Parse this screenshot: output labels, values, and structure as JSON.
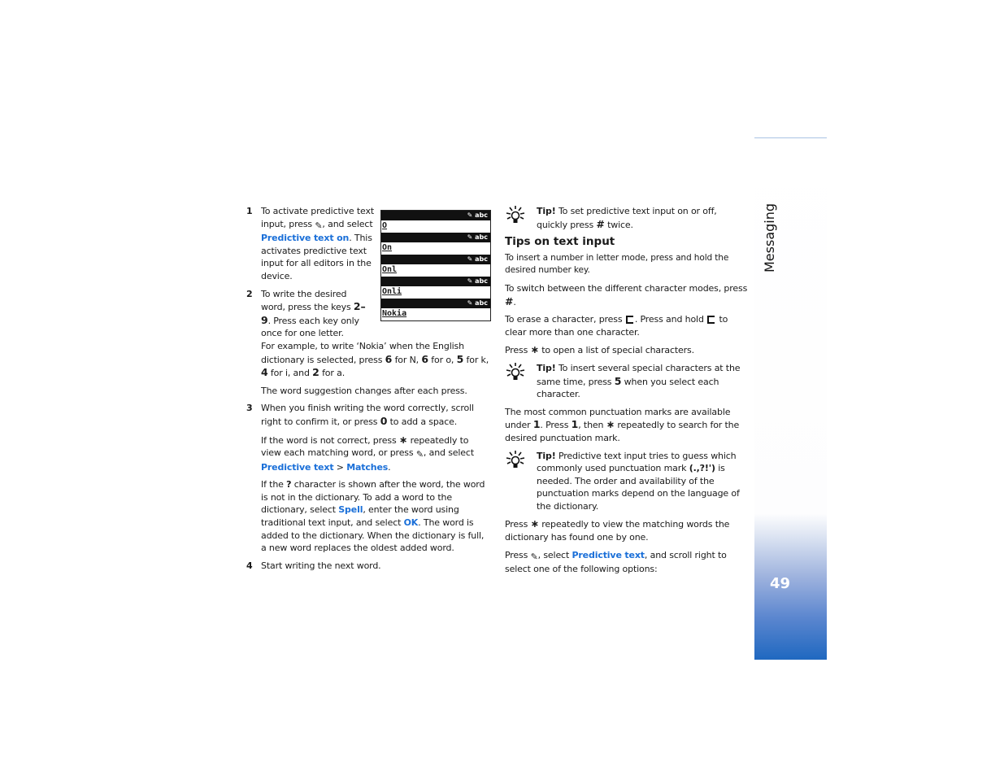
{
  "sidebar": {
    "section_title": "Messaging",
    "page_number": "49",
    "accent_color": "#1f68c0"
  },
  "phone_screen": {
    "status_label": "abc",
    "words": [
      "O",
      "On",
      "Onl",
      "Onli",
      "Nokia"
    ]
  },
  "left_column": {
    "step1": {
      "num": "1",
      "pre": "To activate predictive text input, press",
      "mid": ", and select",
      "link": "Predictive text on",
      "post": ". This activates predictive text input for all editors in the device."
    },
    "step2": {
      "num": "2",
      "pre": "To write the desired word, press the keys",
      "keys": "2–9",
      "post": ". Press each key only once for one letter.",
      "example_pre": "For example, to write ‘Nokia’ when the English dictionary is selected, press",
      "k1": "6",
      "t1": "for N,",
      "k2": "6",
      "t2": "for o,",
      "k3": "5",
      "t3": "for k,",
      "k4": "4",
      "t4": "for i, and",
      "k5": "2",
      "t5": "for a.",
      "note": "The word suggestion changes after each press."
    },
    "step3": {
      "num": "3",
      "pre": "When you finish writing the word correctly, scroll right to confirm it, or press",
      "key": "0",
      "post": "to add a space.",
      "p2_pre": "If the word is not correct, press",
      "p2_key": "∗",
      "p2_mid": "repeatedly to view each matching word, or press",
      "p2_mid2": ", and select",
      "p2_link1": "Predictive text",
      "p2_sep": ">",
      "p2_link2": "Matches",
      "p2_end": ".",
      "p3_pre": "If the",
      "p3_key": "?",
      "p3_mid": "character is shown after the word, the word is not in the dictionary. To add a word to the dictionary, select",
      "p3_link1": "Spell",
      "p3_mid2": ", enter the word using traditional text input, and select",
      "p3_link2": "OK",
      "p3_end": ". The word is added to the dictionary. When the dictionary is full, a new word replaces the oldest added word."
    },
    "step4": {
      "num": "4",
      "text": "Start writing the next word."
    }
  },
  "right_column": {
    "tip1": {
      "label": "Tip!",
      "pre": "To set predictive text input on or off, quickly press",
      "key": "#",
      "post": "twice."
    },
    "heading": "Tips on text input",
    "p1": "To insert a number in letter mode, press and hold the desired number key.",
    "p2_pre": "To switch between the different character modes, press",
    "p2_key": "#",
    "p2_end": ".",
    "p3_pre": "To erase a character, press",
    "p3_mid": ". Press and hold",
    "p3_post": "to clear more than one character.",
    "p4_pre": "Press",
    "p4_key": "∗",
    "p4_post": "to open a list of special characters.",
    "tip2": {
      "label": "Tip!",
      "pre": "To insert several special characters at the same time, press",
      "key": "5",
      "post": "when you select each character."
    },
    "p5_pre": "The most common punctuation marks are available under",
    "p5_k1": "1",
    "p5_mid": ". Press",
    "p5_k2": "1",
    "p5_mid2": ", then",
    "p5_k3": "∗",
    "p5_post": "repeatedly to search for the desired punctuation mark.",
    "tip3": {
      "label": "Tip!",
      "pre": "Predictive text input tries to guess which commonly used punctuation mark",
      "marks": "(.,?!')",
      "post": "is needed. The order and availability of the punctuation marks depend on the language of the dictionary."
    },
    "p6_pre": "Press",
    "p6_key": "∗",
    "p6_post": "repeatedly to view the matching words the dictionary has found one by one.",
    "p7_pre": "Press",
    "p7_mid": ", select",
    "p7_link": "Predictive text",
    "p7_post": ", and scroll right to select one of the following options:"
  }
}
